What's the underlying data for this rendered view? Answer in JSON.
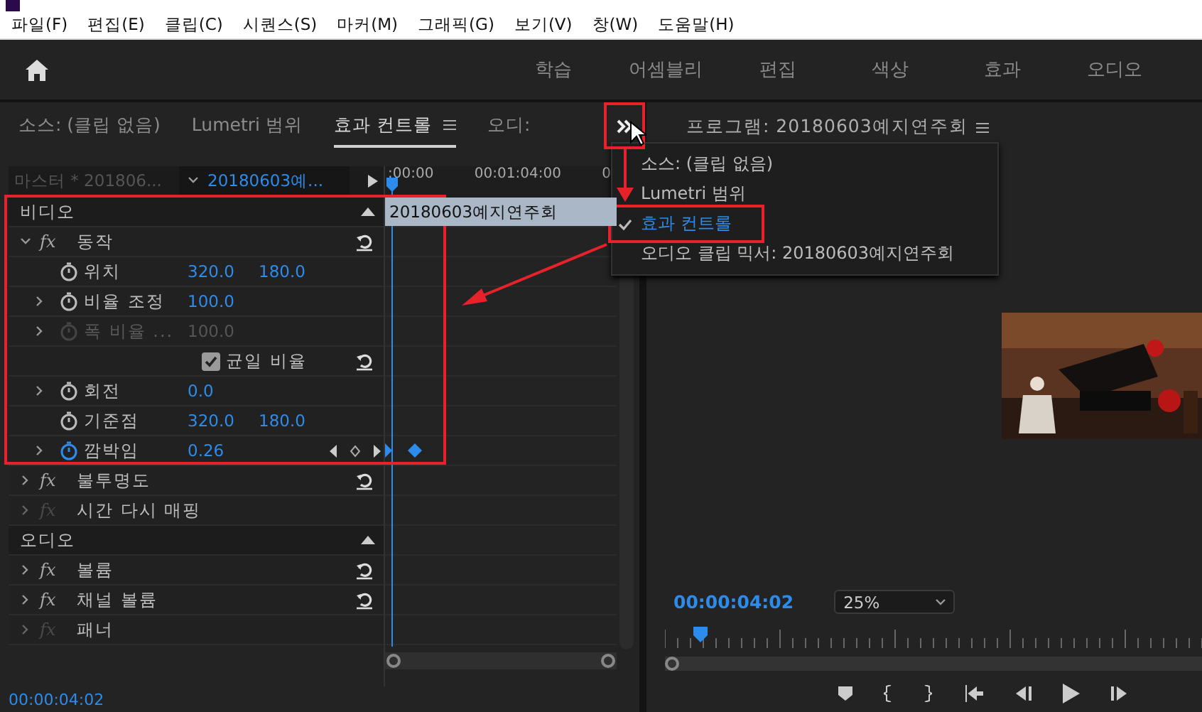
{
  "menu_bar": [
    "파일(F)",
    "편집(E)",
    "클립(C)",
    "시퀀스(S)",
    "마커(M)",
    "그래픽(G)",
    "보기(V)",
    "창(W)",
    "도움말(H)"
  ],
  "workspaces": [
    "학습",
    "어셈블리",
    "편집",
    "색상",
    "효과",
    "오디오"
  ],
  "effect_panel": {
    "tabs": [
      {
        "label": "소스: (클립 없음)",
        "selected": false
      },
      {
        "label": "Lumetri 범위",
        "selected": false
      },
      {
        "label": "효과 컨트롤",
        "selected": true
      },
      {
        "label": "오디:",
        "selected": false
      }
    ],
    "master": "마스터 * 201806...",
    "sequence": "20180603예...",
    "ruler": [
      ":00:00",
      "00:01:04:00",
      "0"
    ],
    "clip": "20180603예지연주회",
    "rows": [
      {
        "kind": "section",
        "label": "비디오"
      },
      {
        "kind": "effect",
        "badge": "fx",
        "label": "동작",
        "expanded": true,
        "enabled": true,
        "reset": true
      },
      {
        "kind": "property",
        "label": "위치",
        "values": [
          "320.0",
          "180.0"
        ],
        "expandable": false,
        "disabled": false,
        "animated": false
      },
      {
        "kind": "property",
        "label": "비율 조정",
        "values": [
          "100.0"
        ],
        "expandable": true,
        "disabled": false,
        "animated": false
      },
      {
        "kind": "property",
        "label": "폭 비율 ...",
        "values": [
          "100.0"
        ],
        "expandable": true,
        "disabled": true,
        "animated": false
      },
      {
        "kind": "checkbox",
        "label": "균일 비율",
        "checked": true
      },
      {
        "kind": "property",
        "label": "회전",
        "values": [
          "0.0"
        ],
        "expandable": true,
        "disabled": false,
        "animated": false
      },
      {
        "kind": "property",
        "label": "기준점",
        "values": [
          "320.0",
          "180.0"
        ],
        "expandable": false,
        "disabled": false,
        "animated": false
      },
      {
        "kind": "property",
        "label": "깜박임",
        "values": [
          "0.26"
        ],
        "expandable": true,
        "disabled": false,
        "animated": true
      },
      {
        "kind": "effect",
        "badge": "fx",
        "label": "불투명도",
        "expanded": false,
        "enabled": true,
        "reset": true
      },
      {
        "kind": "effect",
        "badge": "fx",
        "label": "시간 다시 매핑",
        "expanded": false,
        "enabled": false,
        "reset": false
      },
      {
        "kind": "section",
        "label": "오디오"
      },
      {
        "kind": "effect",
        "badge": "fx",
        "label": "볼륨",
        "expanded": false,
        "enabled": true,
        "reset": true
      },
      {
        "kind": "effect",
        "badge": "fx",
        "label": "채널 볼륨",
        "expanded": false,
        "enabled": true,
        "reset": true
      },
      {
        "kind": "effect",
        "badge": "fx",
        "label": "패너",
        "expanded": false,
        "enabled": false,
        "reset": false
      }
    ],
    "timecode": "00:00:04:02"
  },
  "panel_menu": [
    {
      "label": "소스: (클립 없음)",
      "selected": false
    },
    {
      "label": "Lumetri 범위",
      "selected": false
    },
    {
      "label": "효과 컨트롤",
      "selected": true
    },
    {
      "label": "오디오 클립 믹서: 20180603예지연주회",
      "selected": false
    }
  ],
  "program_monitor": {
    "title": "프로그램: 20180603예지연주회",
    "timecode": "00:00:04:02",
    "zoom": "25%"
  }
}
